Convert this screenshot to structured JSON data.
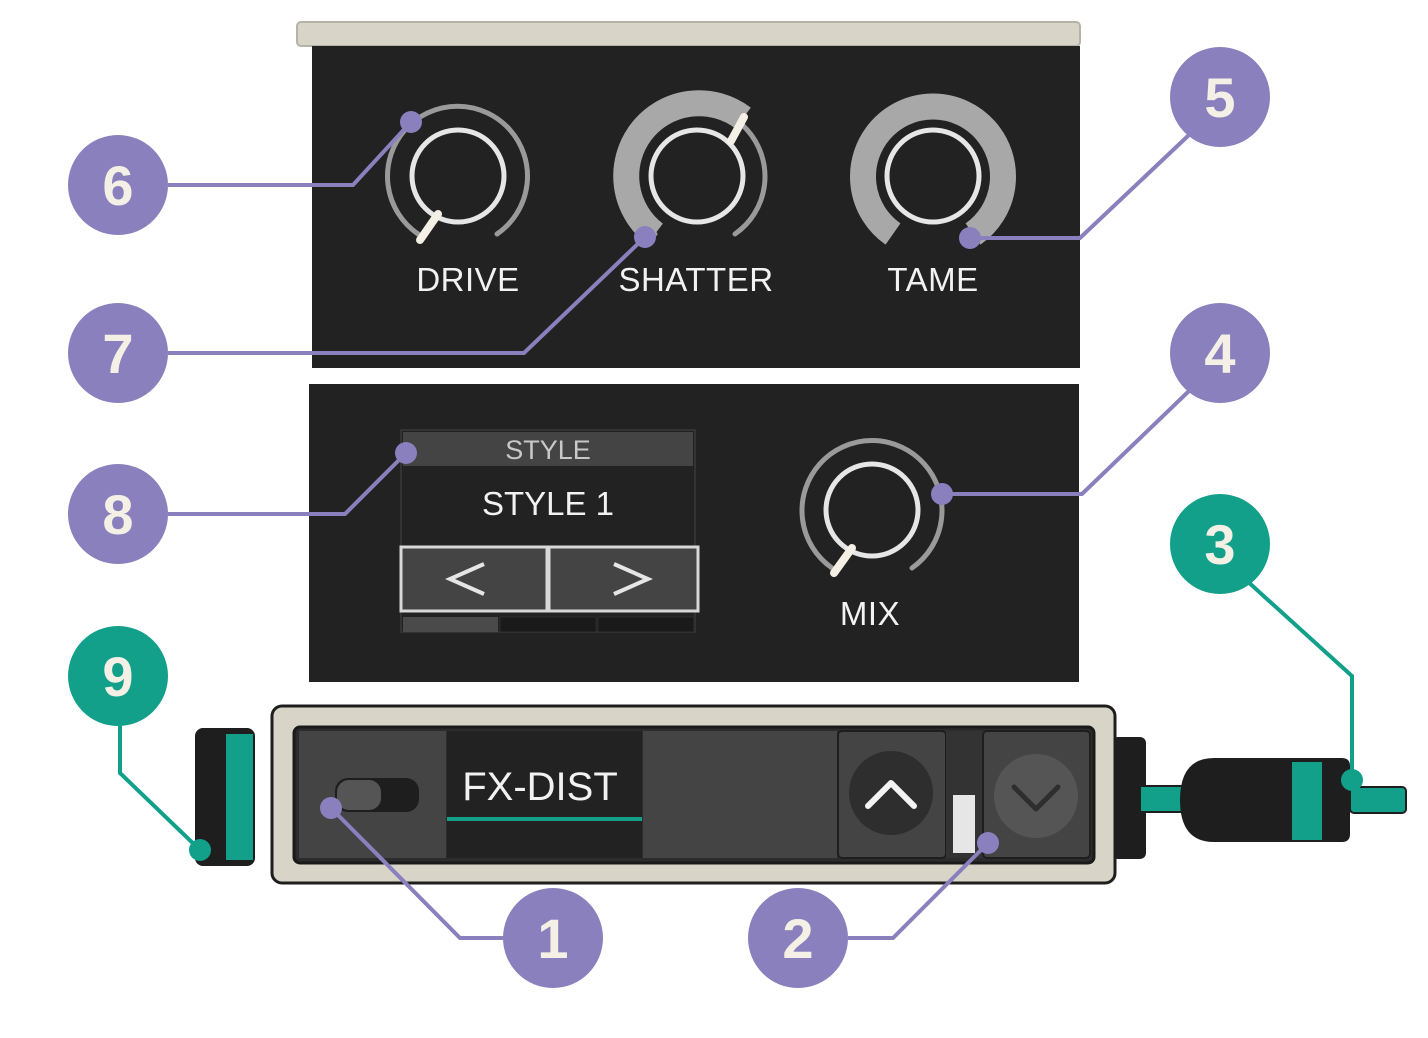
{
  "knobs": {
    "drive": "DRIVE",
    "shatter": "SHATTER",
    "tame": "TAME",
    "mix": "MIX"
  },
  "style_selector": {
    "header": "STYLE",
    "value": "STYLE 1",
    "prev_glyph": "<",
    "next_glyph": ">"
  },
  "device": {
    "name": "FX-DIST"
  },
  "callouts": [
    "1",
    "2",
    "3",
    "4",
    "5",
    "6",
    "7",
    "8",
    "9"
  ],
  "colors": {
    "panel": "#222222",
    "callout_purple": "#8a80bd",
    "callout_teal": "#13a08a",
    "knob_arc": "#9a9a9a",
    "knob_ring": "#e6e6e6",
    "frame": "#d8d5c8"
  }
}
